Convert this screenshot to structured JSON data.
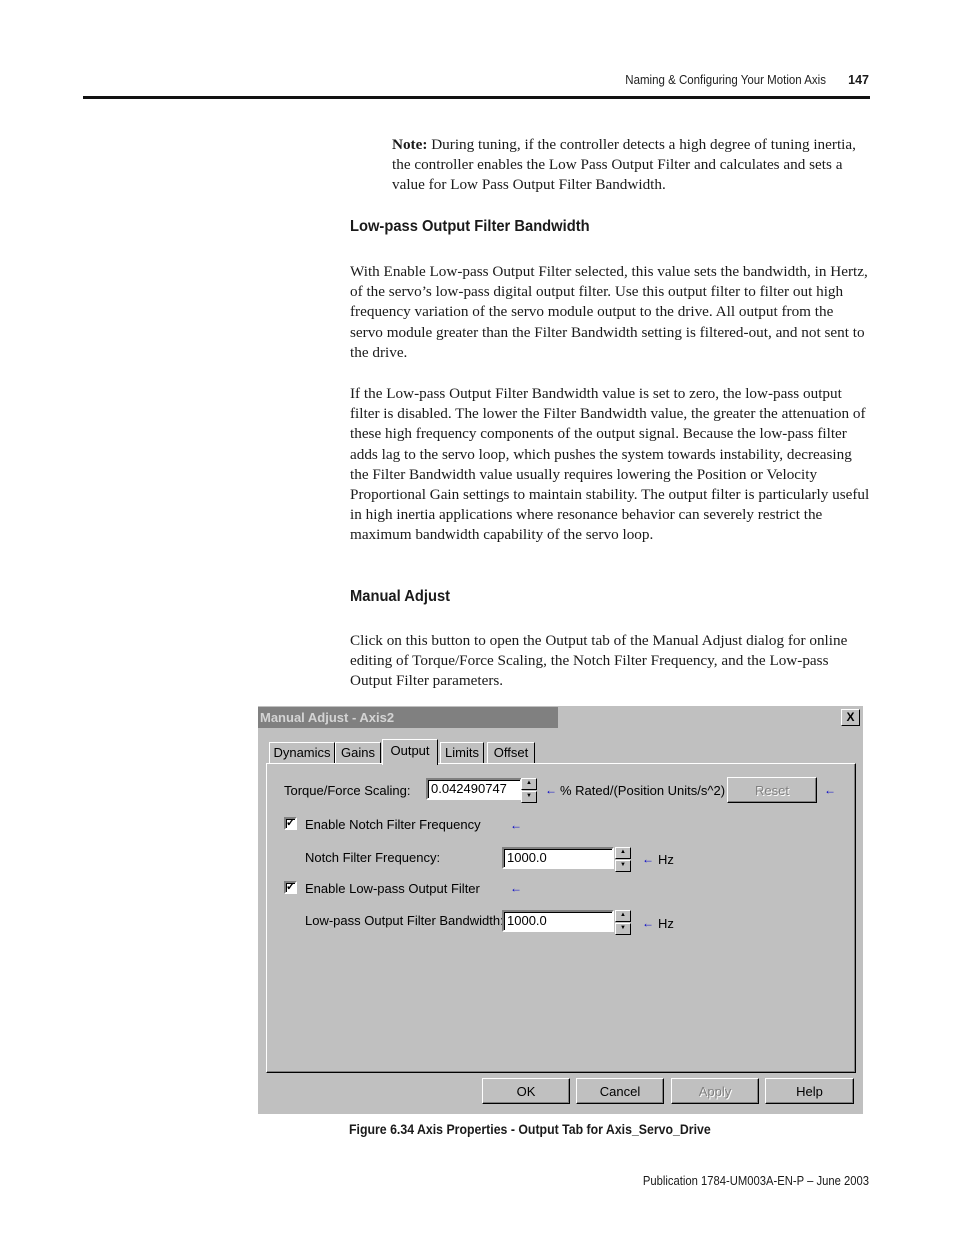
{
  "header": {
    "section_title": "Naming & Configuring Your Motion Axis",
    "page_number": "147"
  },
  "note": {
    "label": "Note:",
    "text": " During tuning, if the controller detects a high degree of tuning inertia, the controller enables the Low Pass Output Filter and calculates and sets a value for Low Pass Output Filter Bandwidth."
  },
  "sections": [
    {
      "heading": "Low-pass Output Filter Bandwidth",
      "paragraphs": [
        "With Enable Low-pass Output Filter selected, this value sets the bandwidth, in Hertz, of the servo’s low-pass digital output filter. Use this output filter to filter out high frequency variation of the servo module output to the drive. All output from the servo module greater than the Filter Bandwidth setting is filtered-out, and not sent to the drive.",
        "If the Low-pass Output Filter Bandwidth value is set to zero, the low-pass output filter is disabled. The lower the Filter Bandwidth value, the greater the attenuation of these high frequency components of the output signal. Because the low-pass filter adds lag to the servo loop, which pushes the system towards instability, decreasing the Filter Bandwidth value usually requires lowering the Position or Velocity Proportional Gain settings to maintain stability. The output filter is particularly useful in high inertia applications where resonance behavior can severely restrict the maximum bandwidth capability of the servo loop."
      ]
    },
    {
      "heading": "Manual Adjust",
      "paragraphs": [
        "Click on this button to open the Output tab of the Manual Adjust dialog for online editing of Torque/Force Scaling, the Notch Filter Frequency, and the Low-pass Output Filter parameters."
      ]
    }
  ],
  "dialog": {
    "title": "Manual Adjust - Axis2",
    "close_glyph": "X",
    "tabs": [
      "Dynamics",
      "Gains",
      "Output",
      "Limits",
      "Offset"
    ],
    "active_tab": "Output",
    "torque_label": "Torque/Force Scaling:",
    "torque_value": "0.042490747",
    "torque_units": "% Rated/(Position Units/s^2)",
    "reset_label": "Reset",
    "notch_enable_label": "Enable Notch Filter Frequency",
    "notch_enable_checked": true,
    "notch_freq_label": "Notch Filter Frequency:",
    "notch_freq_value": "1000.0",
    "notch_units": "Hz",
    "lowpass_enable_label": "Enable Low-pass Output Filter",
    "lowpass_enable_checked": true,
    "lowpass_bw_label": "Low-pass Output Filter Bandwidth:",
    "lowpass_bw_value": "1000.0",
    "lowpass_units": "Hz",
    "arrow_glyph": "🡐",
    "check_glyph": "✓",
    "buttons": {
      "ok": "OK",
      "cancel": "Cancel",
      "apply": "Apply",
      "help": "Help"
    }
  },
  "figure_caption": "Figure 6.34 Axis Properties - Output Tab for Axis_Servo_Drive",
  "footer": "Publication 1784-UM003A-EN-P – June 2003"
}
